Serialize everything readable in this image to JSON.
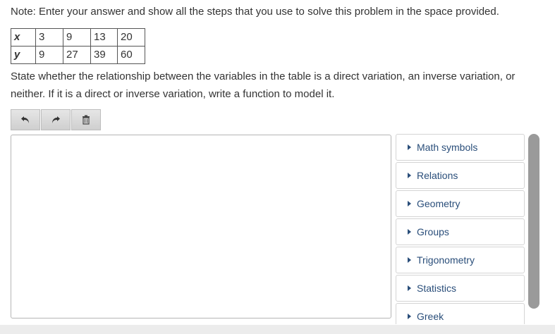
{
  "note": "Note: Enter your answer and show all the steps that you use to solve this problem in the space provided.",
  "table": {
    "rows": [
      {
        "label": "x",
        "values": [
          "3",
          "9",
          "13",
          "20"
        ]
      },
      {
        "label": "y",
        "values": [
          "9",
          "27",
          "39",
          "60"
        ]
      }
    ]
  },
  "question": "State whether the relationship between the variables in the table is a direct variation, an inverse variation, or neither.  If it is a direct or inverse variation, write a function to model it.",
  "toolbar": {
    "undo_icon": "undo-icon",
    "redo_icon": "redo-icon",
    "delete_icon": "trash-icon"
  },
  "palette": {
    "items": [
      {
        "label": "Math symbols"
      },
      {
        "label": "Relations"
      },
      {
        "label": "Geometry"
      },
      {
        "label": "Groups"
      },
      {
        "label": "Trigonometry"
      },
      {
        "label": "Statistics"
      },
      {
        "label": "Greek"
      }
    ]
  },
  "colors": {
    "link": "#2a4e7a",
    "toolbar_button": "#d9d9d9",
    "scrollbar": "#9a9a9a"
  }
}
